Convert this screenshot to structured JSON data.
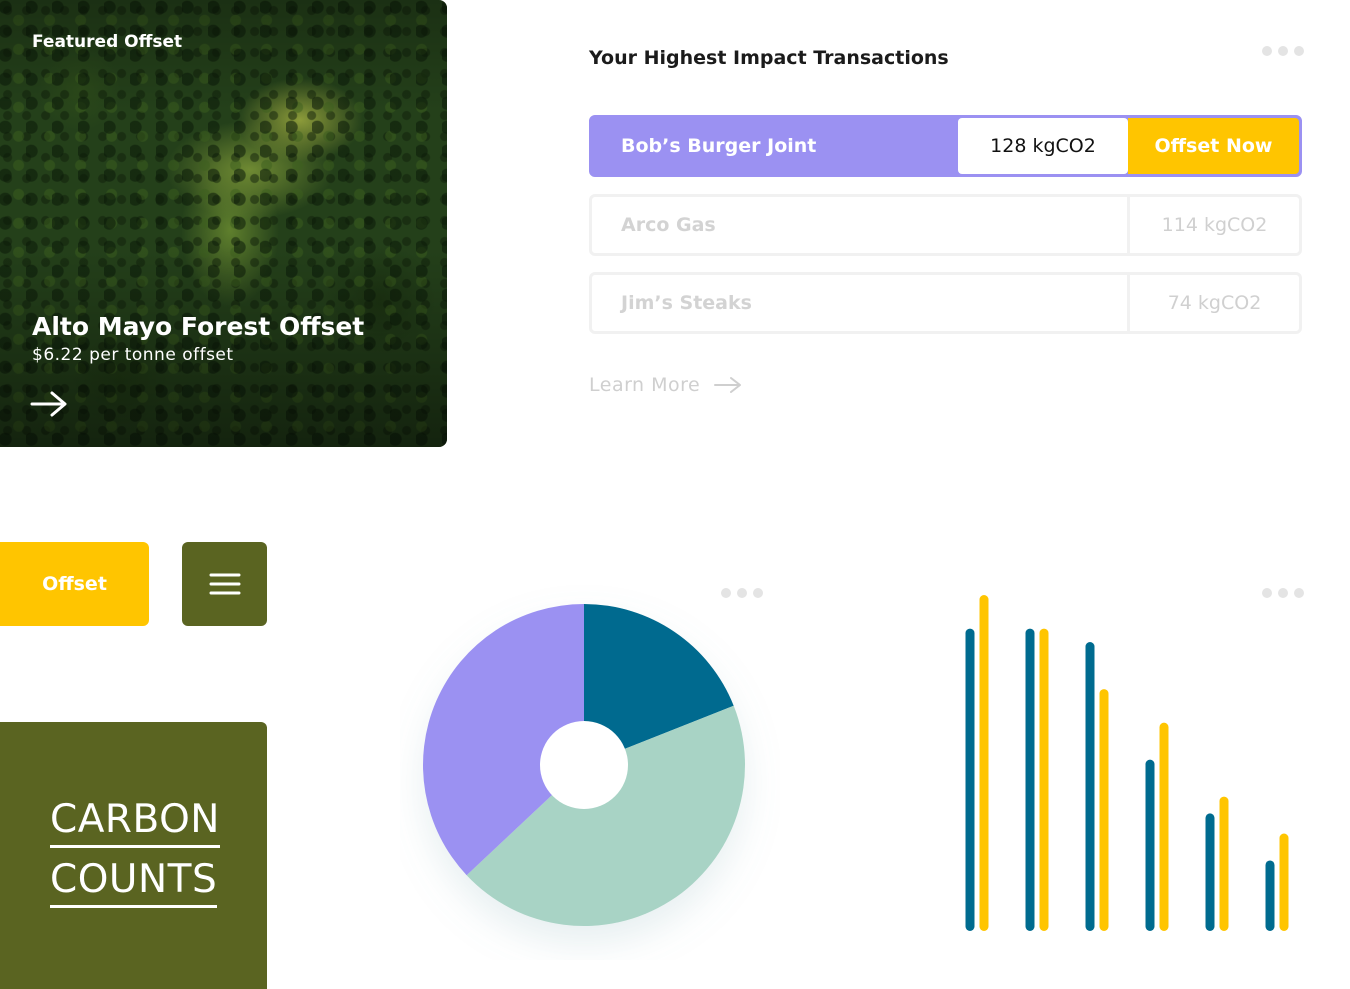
{
  "featured": {
    "label": "Featured Offset",
    "title": "Alto Mayo Forest Offset",
    "price": "$6.22 per tonne offset"
  },
  "transactions": {
    "title": "Your Highest Impact Transactions",
    "items": [
      {
        "name": "Bob’s Burger Joint",
        "amount": "128 kgCO2",
        "action": "Offset Now"
      },
      {
        "name": "Arco Gas",
        "amount": "114 kgCO2"
      },
      {
        "name": "Jim’s Steaks",
        "amount": "74 kgCO2"
      }
    ],
    "learn_more": "Learn More"
  },
  "buttons": {
    "offset_label": "Offset",
    "menu_icon": "hamburger-icon"
  },
  "carbon_tile": {
    "line1": "CARBON",
    "line2": "COUNTS"
  },
  "colors": {
    "purple": "#9b91f2",
    "yellow": "#ffc500",
    "olive": "#5a6421",
    "teal": "#006b8f",
    "mint": "#a8d3c5"
  },
  "chart_data": [
    {
      "type": "pie",
      "slices": [
        {
          "value": 19,
          "color": "#006b8f"
        },
        {
          "value": 44,
          "color": "#a8d3c5"
        },
        {
          "value": 37,
          "color": "#9b91f2"
        }
      ]
    },
    {
      "type": "bar",
      "categories": [
        "",
        "",
        "",
        "",
        "",
        ""
      ],
      "series": [
        {
          "color": "#006b8f",
          "values": [
            90,
            90,
            86,
            51,
            35,
            21
          ]
        },
        {
          "color": "#ffc500",
          "values": [
            100,
            90,
            72,
            62,
            40,
            29
          ]
        }
      ],
      "ylim": [
        0,
        100
      ]
    }
  ]
}
